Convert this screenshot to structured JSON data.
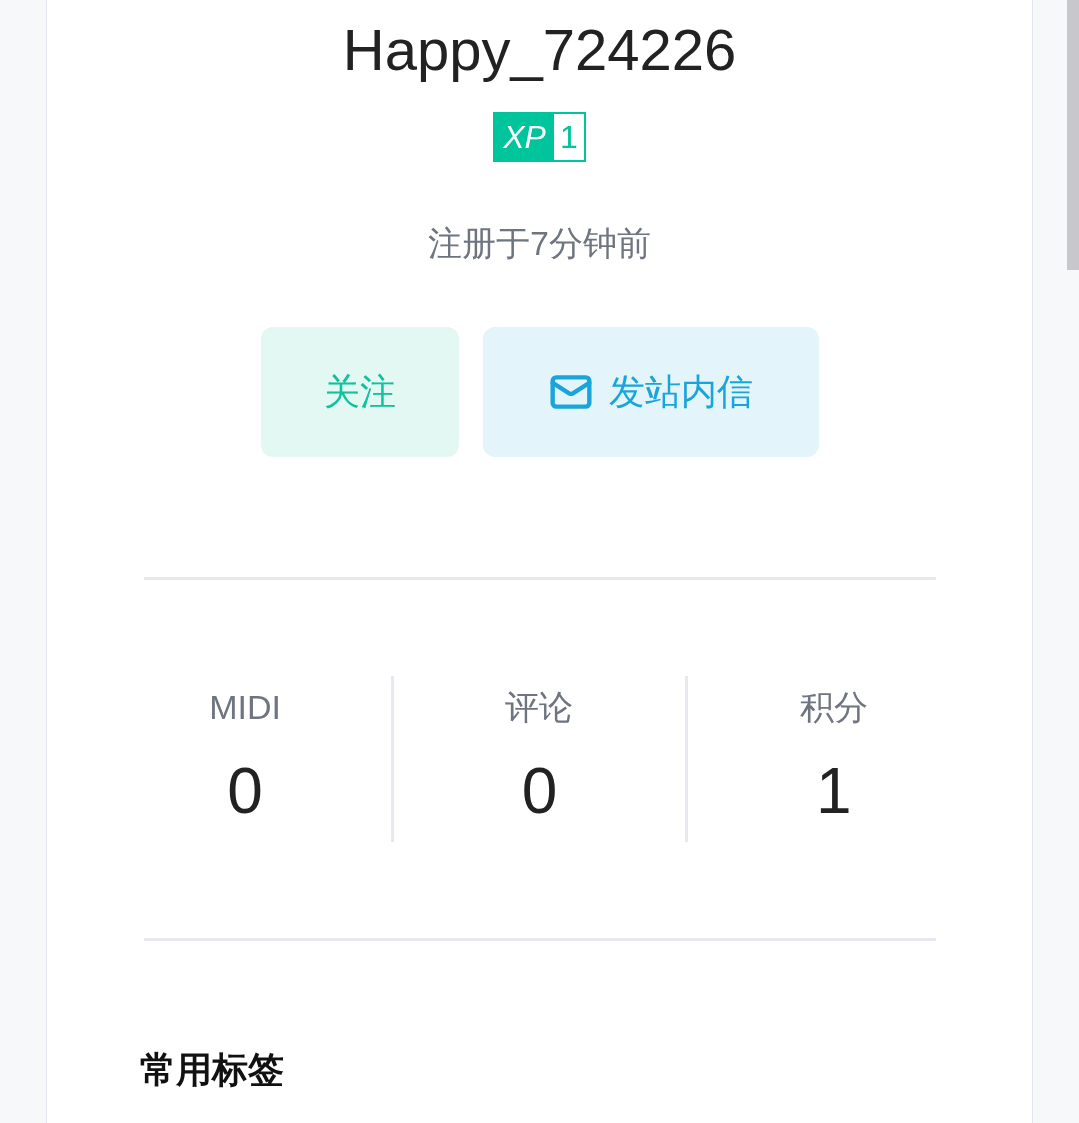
{
  "profile": {
    "username": "Happy_724226",
    "xp_badge": {
      "label": "XP",
      "value": "1"
    },
    "registered": "注册于7分钟前"
  },
  "actions": [
    {
      "kind": "follow",
      "label": "关注"
    },
    {
      "kind": "message",
      "label": "发站内信"
    }
  ],
  "stats": [
    {
      "label": "MIDI",
      "value": "0"
    },
    {
      "label": "评论",
      "value": "0"
    },
    {
      "label": "积分",
      "value": "1"
    }
  ],
  "section_heading": "常用标签"
}
